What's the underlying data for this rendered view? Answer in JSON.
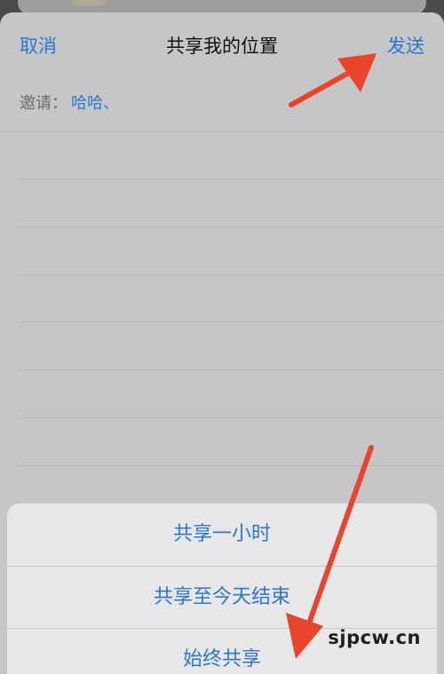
{
  "nav": {
    "cancel_label": "取消",
    "title": "共享我的位置",
    "send_label": "发送"
  },
  "invite": {
    "label": "邀请：",
    "recipients": "哈哈、"
  },
  "action_sheet": {
    "items": [
      {
        "label": "共享一小时"
      },
      {
        "label": "共享至今天结束"
      },
      {
        "label": "始终共享"
      }
    ]
  },
  "watermark": "sjpcw.cn",
  "colors": {
    "accent": "#2c77c9",
    "annotation_arrow": "#e8452c",
    "sheet_background": "#c6c6c8",
    "action_sheet_background": "#e7e7ea"
  }
}
